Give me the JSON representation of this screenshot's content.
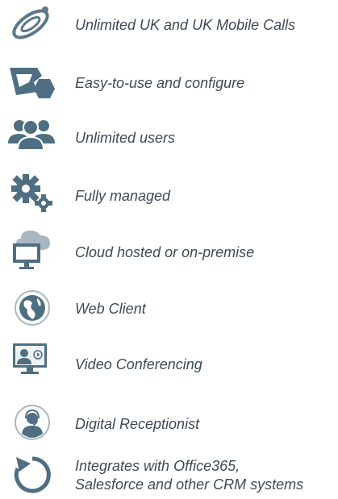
{
  "features": [
    {
      "icon": "phone-loop-icon",
      "label": "Unlimited UK and UK Mobile Calls"
    },
    {
      "icon": "shapes-icon",
      "label": "Easy-to-use and configure"
    },
    {
      "icon": "users-icon",
      "label": "Unlimited users"
    },
    {
      "icon": "gears-icon",
      "label": "Fully managed"
    },
    {
      "icon": "cloud-monitor-icon",
      "label": "Cloud hosted or on-premise"
    },
    {
      "icon": "globe-icon",
      "label": "Web Client"
    },
    {
      "icon": "video-conference-icon",
      "label": "Video Conferencing"
    },
    {
      "icon": "receptionist-icon",
      "label": "Digital Receptionist"
    },
    {
      "icon": "refresh-icon",
      "label": "Integrates with Office365,",
      "label_line2": "Salesforce and other CRM systems"
    }
  ],
  "colors": {
    "icon": "#4f6e82",
    "icon_light": "#a9b7c1",
    "text": "#3d4a52"
  }
}
